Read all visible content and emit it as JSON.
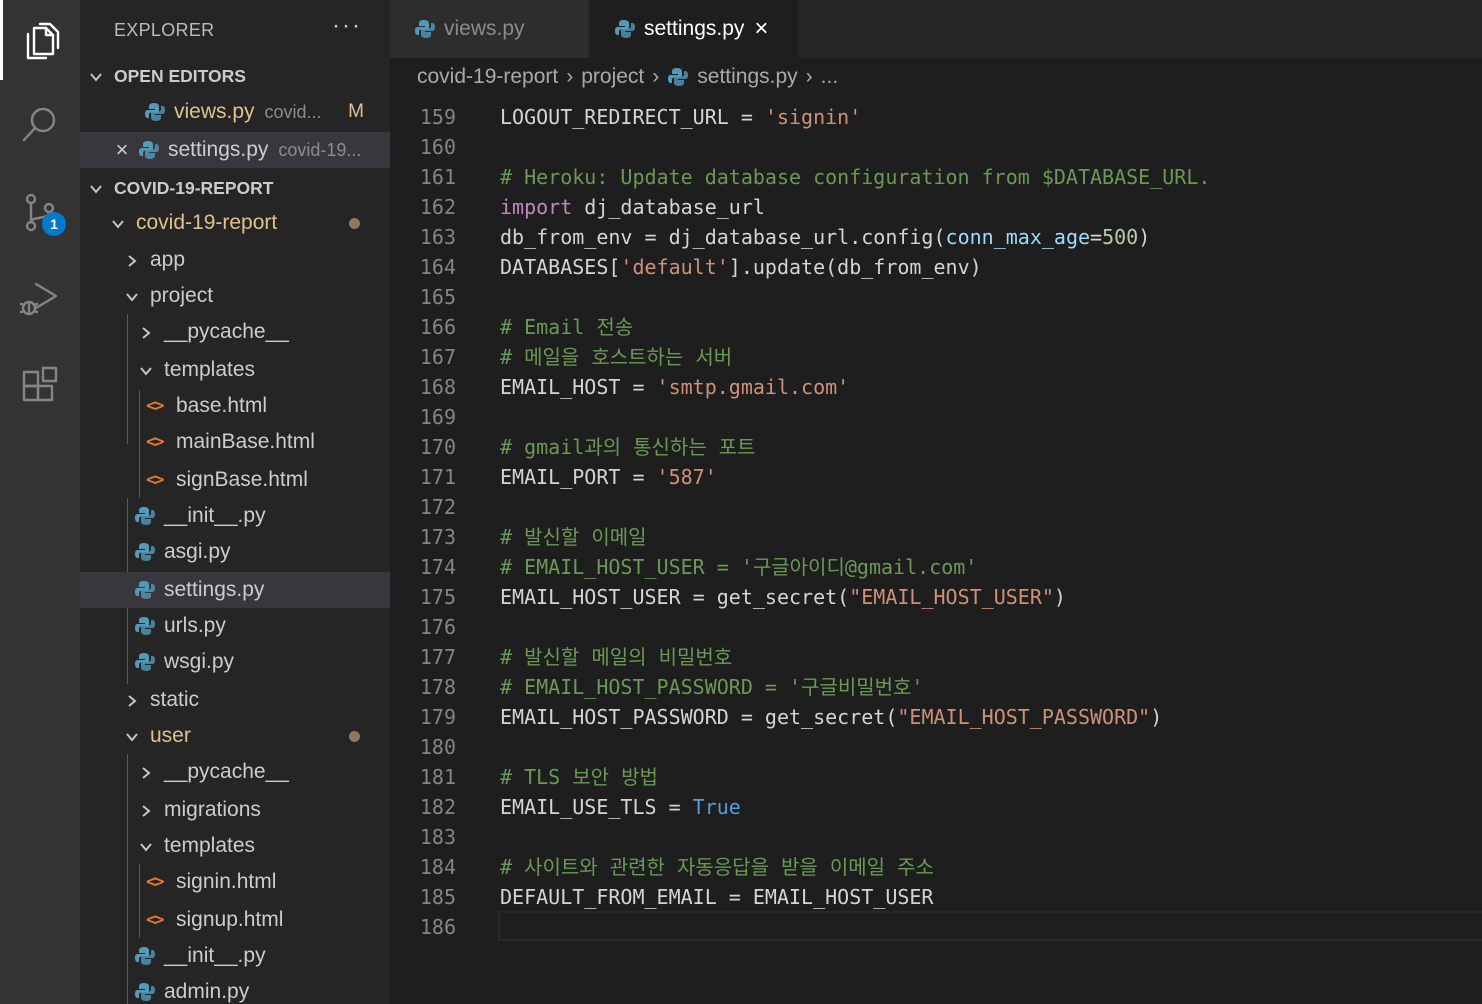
{
  "activity_bar": {
    "items": [
      {
        "name": "explorer",
        "icon": "files-icon",
        "active": true
      },
      {
        "name": "search",
        "icon": "search-icon"
      },
      {
        "name": "source-control",
        "icon": "source-control-icon",
        "badge": "1"
      },
      {
        "name": "run-debug",
        "icon": "run-debug-icon"
      },
      {
        "name": "extensions",
        "icon": "extensions-icon"
      }
    ]
  },
  "sidebar": {
    "title": "EXPLORER",
    "more": "···",
    "open_editors": {
      "label": "OPEN EDITORS",
      "items": [
        {
          "name": "views.py",
          "desc": "covid...",
          "flag": "M"
        },
        {
          "name": "settings.py",
          "desc": "covid-19..."
        }
      ]
    },
    "project": {
      "label": "COVID-19-REPORT",
      "tree": [
        {
          "label": "covid-19-report"
        },
        {
          "label": "app"
        },
        {
          "label": "project"
        },
        {
          "label": "__pycache__"
        },
        {
          "label": "templates"
        },
        {
          "label": "base.html"
        },
        {
          "label": "mainBase.html"
        },
        {
          "label": "signBase.html"
        },
        {
          "label": "__init__.py"
        },
        {
          "label": "asgi.py"
        },
        {
          "label": "settings.py"
        },
        {
          "label": "urls.py"
        },
        {
          "label": "wsgi.py"
        },
        {
          "label": "static"
        },
        {
          "label": "user"
        },
        {
          "label": "__pycache__"
        },
        {
          "label": "migrations"
        },
        {
          "label": "templates"
        },
        {
          "label": "signin.html"
        },
        {
          "label": "signup.html"
        },
        {
          "label": "__init__.py"
        },
        {
          "label": "admin.py"
        }
      ]
    }
  },
  "tabs": [
    {
      "label": "views.py",
      "active": false
    },
    {
      "label": "settings.py",
      "active": true,
      "close": "×"
    }
  ],
  "breadcrumb": [
    "covid-19-report",
    "project",
    "settings.py",
    "..."
  ],
  "editor": {
    "lines": [
      {
        "n": "159",
        "t": [
          [
            "",
            "LOGOUT_REDIRECT_URL = "
          ],
          [
            "str",
            "'signin'"
          ]
        ]
      },
      {
        "n": "160",
        "t": []
      },
      {
        "n": "161",
        "t": [
          [
            "cmt",
            "# Heroku: Update database configuration from $DATABASE_URL."
          ]
        ]
      },
      {
        "n": "162",
        "t": [
          [
            "kw",
            "import"
          ],
          [
            "",
            " dj_database_url"
          ]
        ]
      },
      {
        "n": "163",
        "t": [
          [
            "",
            "db_from_env = dj_database_url.config("
          ],
          [
            "param",
            "conn_max_age"
          ],
          [
            "",
            "="
          ],
          [
            "num",
            "500"
          ],
          [
            "",
            ")"
          ]
        ]
      },
      {
        "n": "164",
        "t": [
          [
            "",
            "DATABASES["
          ],
          [
            "str",
            "'default'"
          ],
          [
            "",
            "].update(db_from_env)"
          ]
        ]
      },
      {
        "n": "165",
        "t": []
      },
      {
        "n": "166",
        "t": [
          [
            "cmt",
            "# Email 전송"
          ]
        ]
      },
      {
        "n": "167",
        "t": [
          [
            "cmt",
            "# 메일을 호스트하는 서버"
          ]
        ]
      },
      {
        "n": "168",
        "t": [
          [
            "",
            "EMAIL_HOST = "
          ],
          [
            "str",
            "'smtp.gmail.com'"
          ]
        ]
      },
      {
        "n": "169",
        "t": []
      },
      {
        "n": "170",
        "t": [
          [
            "cmt",
            "# gmail과의 통신하는 포트"
          ]
        ]
      },
      {
        "n": "171",
        "t": [
          [
            "",
            "EMAIL_PORT = "
          ],
          [
            "str",
            "'587'"
          ]
        ]
      },
      {
        "n": "172",
        "t": []
      },
      {
        "n": "173",
        "t": [
          [
            "cmt",
            "# 발신할 이메일"
          ]
        ]
      },
      {
        "n": "174",
        "t": [
          [
            "cmt",
            "# EMAIL_HOST_USER = '구글아이디@gmail.com'"
          ]
        ]
      },
      {
        "n": "175",
        "t": [
          [
            "",
            "EMAIL_HOST_USER = get_secret("
          ],
          [
            "str",
            "\"EMAIL_HOST_USER\""
          ],
          [
            "",
            ")"
          ]
        ]
      },
      {
        "n": "176",
        "t": []
      },
      {
        "n": "177",
        "t": [
          [
            "cmt",
            "# 발신할 메일의 비밀번호"
          ]
        ]
      },
      {
        "n": "178",
        "t": [
          [
            "cmt",
            "# EMAIL_HOST_PASSWORD = '구글비밀번호'"
          ]
        ]
      },
      {
        "n": "179",
        "t": [
          [
            "",
            "EMAIL_HOST_PASSWORD = get_secret("
          ],
          [
            "str",
            "\"EMAIL_HOST_PASSWORD\""
          ],
          [
            "",
            ")"
          ]
        ]
      },
      {
        "n": "180",
        "t": []
      },
      {
        "n": "181",
        "t": [
          [
            "cmt",
            "# TLS 보안 방법"
          ]
        ]
      },
      {
        "n": "182",
        "t": [
          [
            "",
            "EMAIL_USE_TLS = "
          ],
          [
            "const",
            "True"
          ]
        ]
      },
      {
        "n": "183",
        "t": []
      },
      {
        "n": "184",
        "t": [
          [
            "cmt",
            "# 사이트와 관련한 자동응답을 받을 이메일 주소"
          ]
        ]
      },
      {
        "n": "185",
        "t": [
          [
            "",
            "DEFAULT_FROM_EMAIL = EMAIL_HOST_USER"
          ]
        ]
      },
      {
        "n": "186",
        "t": []
      }
    ]
  },
  "colors": {
    "modified": "#e2c08d",
    "accent": "#007acc",
    "html_icon": "#e37933"
  }
}
